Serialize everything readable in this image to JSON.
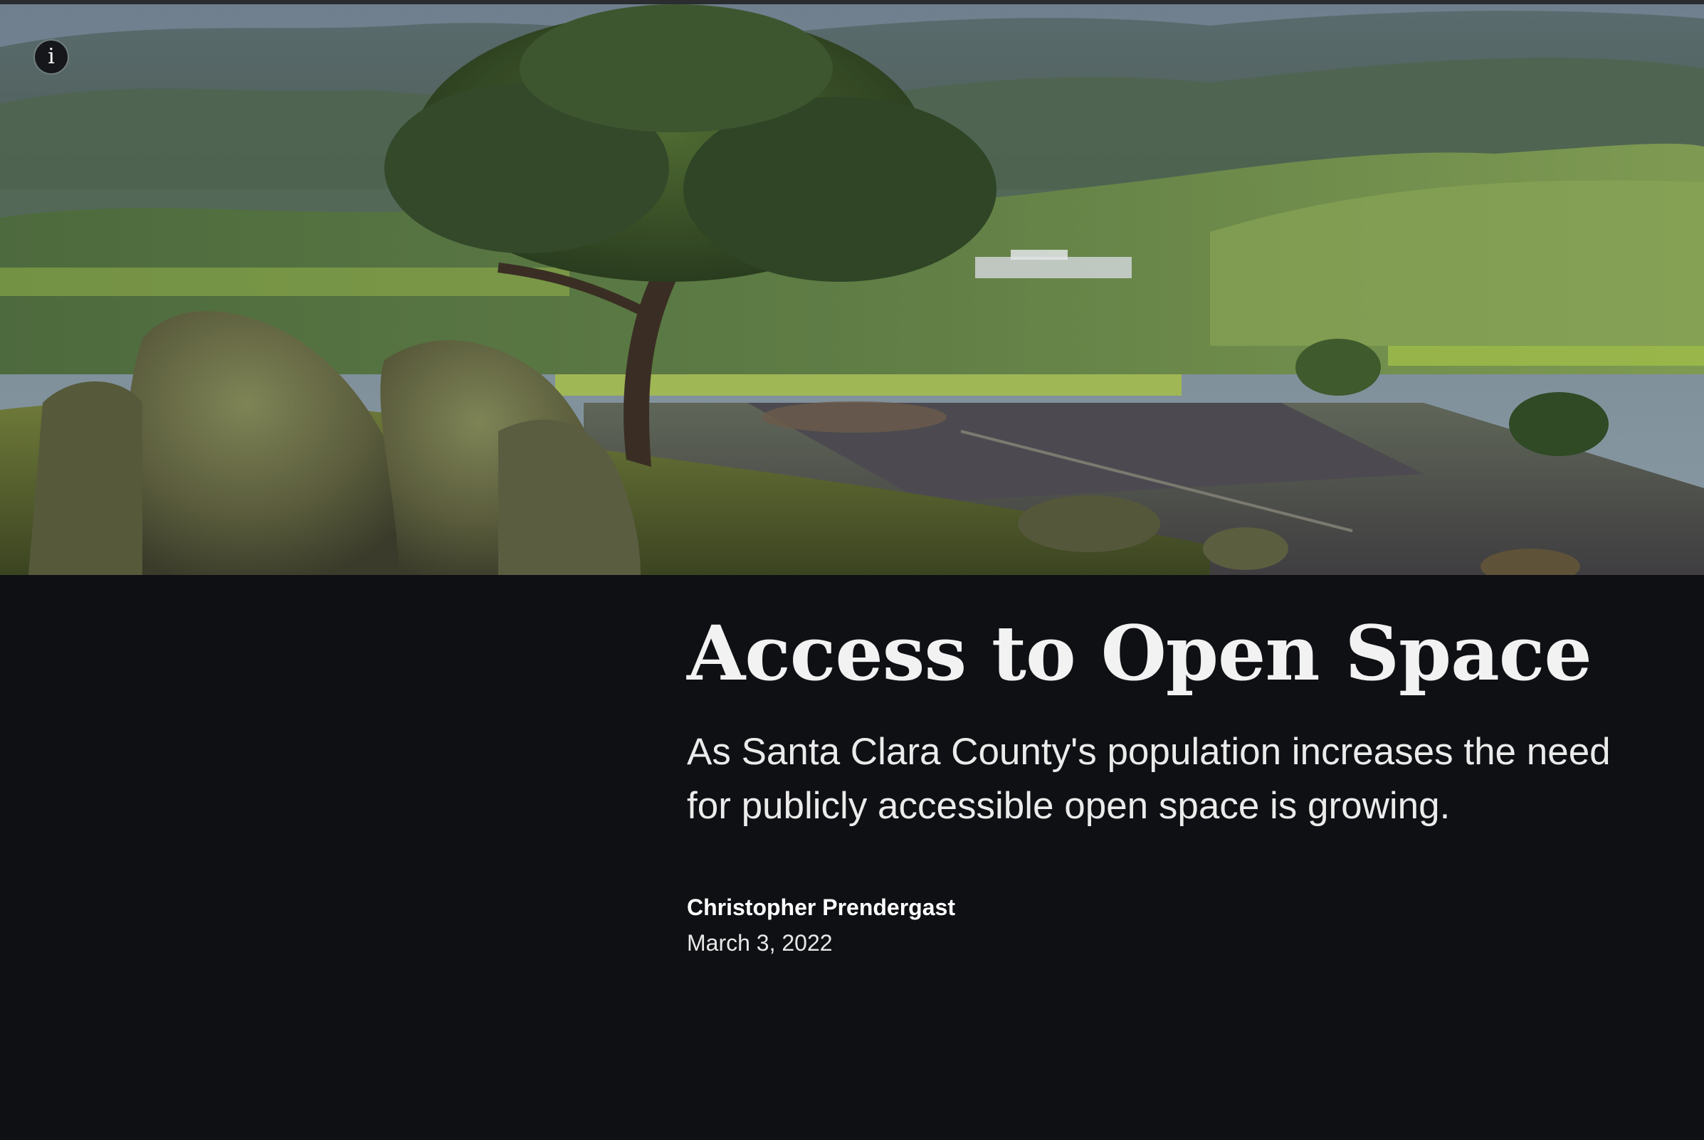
{
  "hero": {
    "image": "landscape-photo",
    "info_icon": "info-icon",
    "info_glyph": "i"
  },
  "article": {
    "title": "Access to Open Space",
    "subtitle": "As Santa Clara County's population increases the need for publicly accessible open space is growing.",
    "author": "Christopher Prendergast",
    "date": "March 3, 2022"
  },
  "colors": {
    "background": "#0f1014",
    "title_text": "#f2f2f2",
    "body_text": "#ebebeb"
  }
}
